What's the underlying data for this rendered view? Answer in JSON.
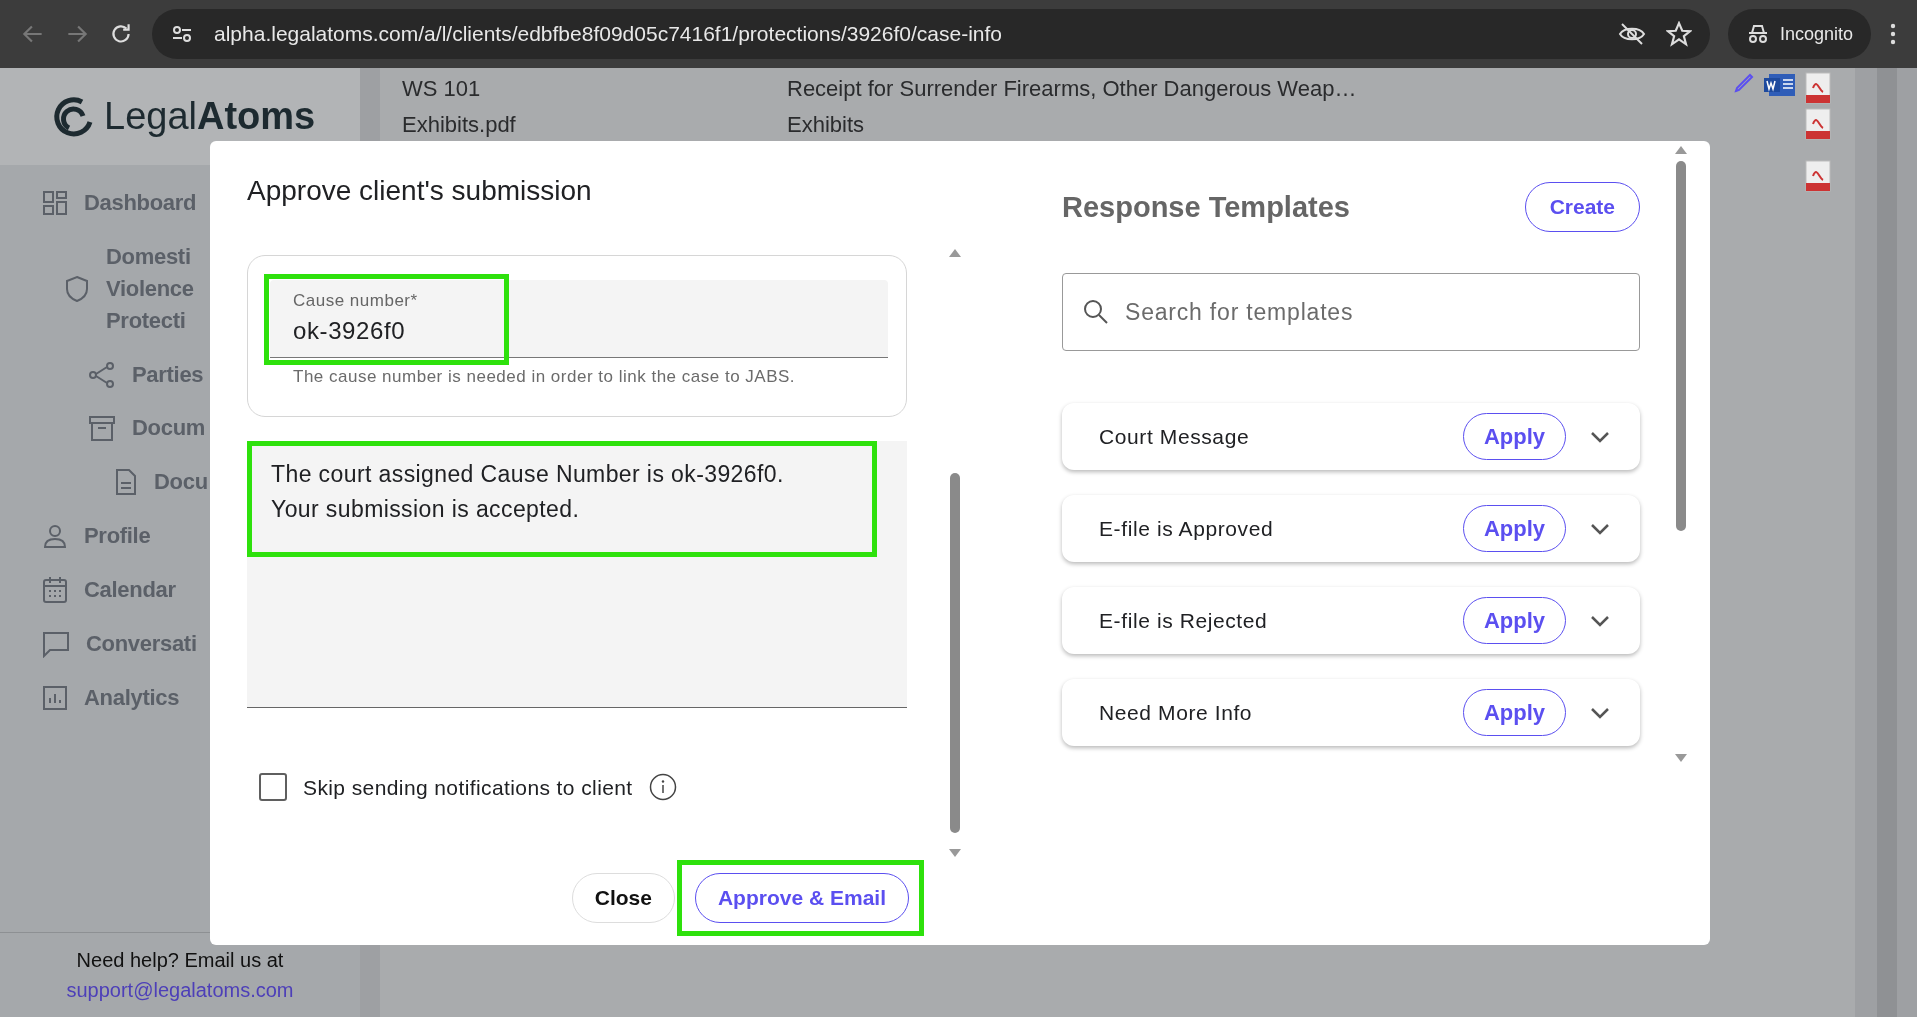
{
  "browser": {
    "url": "alpha.legalatoms.com/a/l/clients/edbfbe8f09d05c7416f1/protections/3926f0/case-info",
    "profile": "Incognito"
  },
  "sidebar": {
    "logo": "Legal**Atoms**",
    "items": [
      {
        "lines": [
          "Dashboard"
        ],
        "children": [
          {
            "lines": [
              "Domesti",
              "Violence",
              "Protecti"
            ],
            "children": [
              {
                "lines": [
                  "Parties"
                ]
              },
              {
                "lines": [
                  "Docum"
                ],
                "children": [
                  {
                    "lines": [
                      "Docu"
                    ]
                  }
                ]
              }
            ]
          }
        ]
      },
      {
        "lines": [
          "Profile"
        ]
      },
      {
        "lines": [
          "Calendar"
        ]
      },
      {
        "lines": [
          "Conversati"
        ]
      },
      {
        "lines": [
          "Analytics"
        ]
      }
    ],
    "help": "Need help? Email us at",
    "email": "support@legalatoms.com"
  },
  "background_table": {
    "rows": [
      {
        "name": "WS 101",
        "description": "Receipt for Surrender Firearms, Other Dangerous Weap…"
      },
      {
        "name": "Exhibits.pdf",
        "description": "Exhibits"
      }
    ]
  },
  "modal": {
    "title": "Approve client's submission",
    "cause_field": {
      "label": "Cause number*",
      "value": "ok-3926f0",
      "helper": "The cause number is needed in order to link the case to JABS.",
      "highlighted": true
    },
    "message": {
      "value": "The court assigned Cause Number is ok-3926f0.\nYour submission is accepted.",
      "highlighted": true
    },
    "skip_notifications": {
      "label": "Skip sending notifications to client",
      "checked": false
    },
    "buttons": [
      {
        "label": "Close",
        "kind": "plain",
        "highlighted": false
      },
      {
        "label": "Approve & Email",
        "kind": "outline",
        "highlighted": true
      }
    ]
  },
  "templates": {
    "title": "Response Templates",
    "create": "Create",
    "search_placeholder": "Search for templates",
    "items": [
      {
        "name": "Court Message",
        "action": "Apply",
        "expanded": false
      },
      {
        "name": "E-file is Approved",
        "action": "Apply",
        "expanded": false
      },
      {
        "name": "E-file is Rejected",
        "action": "Apply",
        "expanded": false
      },
      {
        "name": "Need More Info",
        "action": "Apply",
        "expanded": false
      }
    ]
  }
}
